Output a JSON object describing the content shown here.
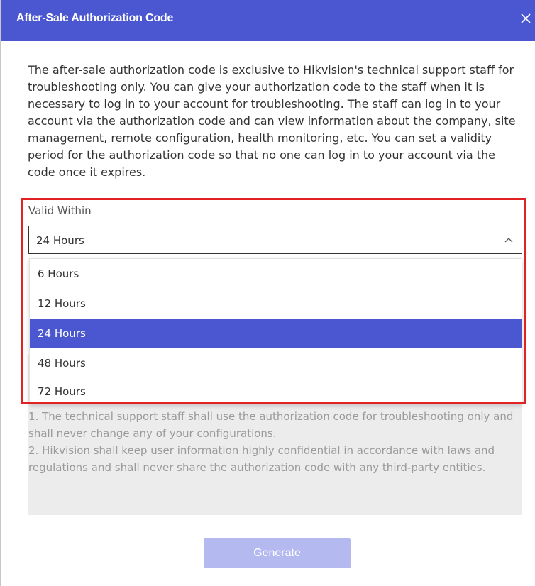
{
  "dialog": {
    "title": "After-Sale Authorization Code",
    "close_icon": "close-icon",
    "description": "The after-sale authorization code is exclusive to Hikvision's technical support staff for troubleshooting only. You can give your authorization code to the staff when it is necessary to log in to your account for troubleshooting. The staff can log in to your account via the authorization code and can view information about the company, site management, remote configuration, health monitoring, etc. You can set a validity period for the authorization code so that no one can log in to your account via the code once it expires."
  },
  "valid_within": {
    "label": "Valid Within",
    "selected": "24 Hours",
    "options": [
      "6 Hours",
      "12 Hours",
      "24 Hours",
      "48 Hours",
      "72 Hours"
    ],
    "selected_index": 2
  },
  "notes": {
    "text": "1. The technical support staff shall use the authorization code for troubleshooting only and shall never change any of your configurations.\n2. Hikvision shall keep user information highly confidential in accordance with laws and regulations and shall never share the authorization code with any third-party entities."
  },
  "actions": {
    "generate_label": "Generate",
    "generate_enabled": false
  },
  "colors": {
    "accent": "#4a57d0",
    "highlight_box": "#e02222",
    "disabled_button": "#b4b9f0"
  }
}
